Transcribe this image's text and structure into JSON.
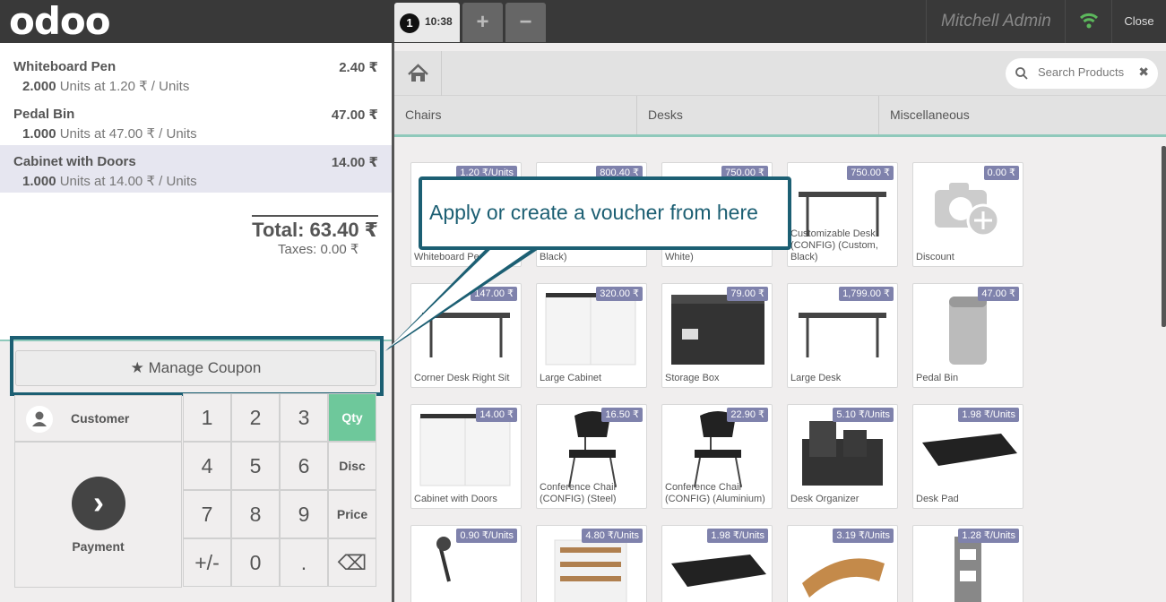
{
  "header": {
    "logo": "odoo",
    "order_tab": {
      "number": "1",
      "time": "10:38"
    },
    "add_label": "+",
    "remove_label": "−",
    "user": "Mitchell Admin",
    "close_label": "Close",
    "wifi_color": "#5cb85c"
  },
  "order": {
    "lines": [
      {
        "name": "Whiteboard Pen",
        "price": "2.40 ₹",
        "qty": "2.000",
        "info": " Units at 1.20 ₹ / Units"
      },
      {
        "name": "Pedal Bin",
        "price": "47.00 ₹",
        "qty": "1.000",
        "info": " Units at 47.00 ₹ / Units"
      },
      {
        "name": "Cabinet with Doors",
        "price": "14.00 ₹",
        "qty": "1.000",
        "info": " Units at 14.00 ₹ / Units"
      }
    ],
    "total": "Total: 63.40 ₹",
    "taxes": "Taxes: 0.00 ₹"
  },
  "controls": {
    "manage_coupon": "Manage Coupon",
    "customer": "Customer",
    "payment": "Payment",
    "keys": [
      "1",
      "2",
      "3",
      "Qty",
      "4",
      "5",
      "6",
      "Disc",
      "7",
      "8",
      "9",
      "Price",
      "+/-",
      "0",
      ".",
      "⌫"
    ]
  },
  "search": {
    "placeholder": "Search Products",
    "clear": "✖"
  },
  "categories": [
    "Chairs",
    "Desks",
    "Miscellaneous"
  ],
  "tooltip": "Apply or create a voucher from here",
  "products": [
    {
      "name": "Whiteboard Pen",
      "price": "1.20 ₹/Units",
      "icon": "pen-image"
    },
    {
      "name": "Black)",
      "price": "800.40 ₹",
      "icon": "desk-image"
    },
    {
      "name": "White)",
      "price": "750.00 ₹",
      "icon": "desk-image"
    },
    {
      "name": "Customizable Desk (CONFIG) (Custom, Black)",
      "price": "750.00 ₹",
      "icon": "desk-image"
    },
    {
      "name": "Discount",
      "price": "0.00 ₹",
      "icon": "camera-plus-image"
    },
    {
      "name": "Corner Desk Right Sit",
      "price": "147.00 ₹",
      "icon": "desk-image"
    },
    {
      "name": "Large Cabinet",
      "price": "320.00 ₹",
      "icon": "cabinet-image"
    },
    {
      "name": "Storage Box",
      "price": "79.00 ₹",
      "icon": "box-image"
    },
    {
      "name": "Large Desk",
      "price": "1,799.00 ₹",
      "icon": "desk-image"
    },
    {
      "name": "Pedal Bin",
      "price": "47.00 ₹",
      "icon": "bin-image"
    },
    {
      "name": "Cabinet with Doors",
      "price": "14.00 ₹",
      "icon": "cabinet-image"
    },
    {
      "name": "Conference Chair (CONFIG) (Steel)",
      "price": "16.50 ₹",
      "icon": "chair-image"
    },
    {
      "name": "Conference Chair (CONFIG) (Aluminium)",
      "price": "22.90 ₹",
      "icon": "chair-image"
    },
    {
      "name": "Desk Organizer",
      "price": "5.10 ₹/Units",
      "icon": "organizer-image"
    },
    {
      "name": "Desk Pad",
      "price": "1.98 ₹/Units",
      "icon": "pad-image"
    },
    {
      "name": "",
      "price": "0.90 ₹/Units",
      "icon": "lamp-image"
    },
    {
      "name": "",
      "price": "4.80 ₹/Units",
      "icon": "tray-image"
    },
    {
      "name": "",
      "price": "1.98 ₹/Units",
      "icon": "pad-image"
    },
    {
      "name": "",
      "price": "3.19 ₹/Units",
      "icon": "stand-image"
    },
    {
      "name": "",
      "price": "1.28 ₹/Units",
      "icon": "holder-image"
    }
  ]
}
